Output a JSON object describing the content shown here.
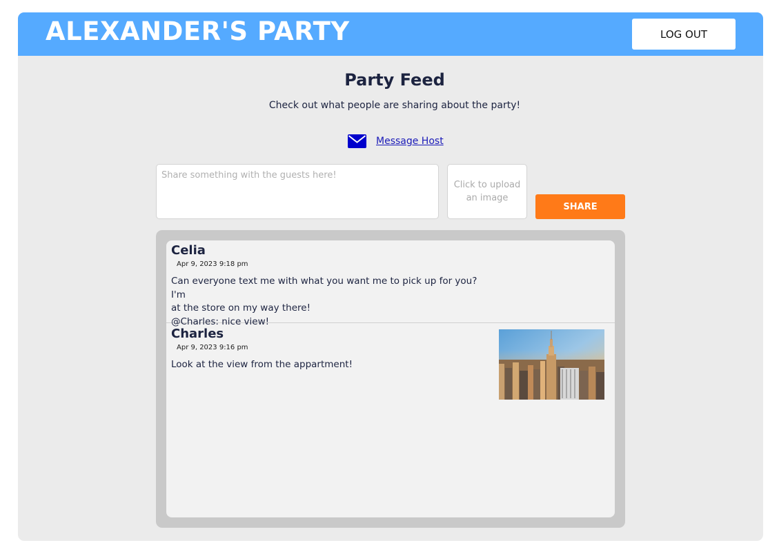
{
  "header": {
    "title": "ALEXANDER'S PARTY",
    "logout_label": "LOG OUT"
  },
  "feed": {
    "title": "Party Feed",
    "subtitle": "Check out what people are sharing about the party!",
    "message_host_label": "Message Host"
  },
  "composer": {
    "placeholder": "Share something with the guests here!",
    "upload_label": "Click to upload an image",
    "share_label": "SHARE"
  },
  "posts": [
    {
      "author": "Celia",
      "timestamp": "Apr 9, 2023 9:18 pm",
      "lines": [
        "Can everyone text me with what you want me to pick up for you? I'm",
        "at the store on my way there!",
        "@Charles: nice view!"
      ]
    },
    {
      "author": "Charles",
      "timestamp": "Apr 9, 2023 9:16 pm",
      "lines": [
        "Look at the view from the appartment!"
      ],
      "image_icon": "city-skyline-photo"
    }
  ],
  "colors": {
    "brand_blue": "#55aaff",
    "accent_orange": "#ff7a18",
    "navy_text": "#1c2340",
    "link_blue": "#1a1ab8",
    "envelope_blue": "#0000cc"
  }
}
